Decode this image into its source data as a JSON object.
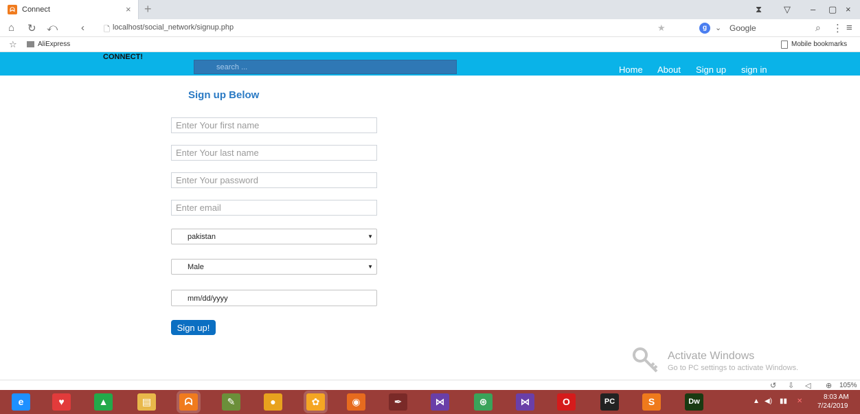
{
  "browser": {
    "tab_title": "Connect",
    "tab_favicon": "connect-icon",
    "tab_close": "×",
    "new_tab": "+",
    "url": "localhost/social_network/signup.php",
    "search_engine": "Google",
    "window_controls": [
      "⧗",
      "▽",
      "–",
      "▢",
      "×"
    ]
  },
  "bookmarks": {
    "items": [
      {
        "label": "AliExpress"
      }
    ],
    "mobile_label": "Mobile bookmarks"
  },
  "site": {
    "brand": "CONNECT!",
    "search_placeholder": "search ...",
    "nav": [
      "Home",
      "About",
      "Sign up",
      "sign in"
    ],
    "accent": "#0ab3e8"
  },
  "form": {
    "title": "Sign up Below",
    "first_name_placeholder": "Enter Your first name",
    "last_name_placeholder": "Enter Your last name",
    "password_placeholder": "Enter Your password",
    "email_placeholder": "Enter email",
    "country_value": "pakistan",
    "gender_value": "Male",
    "date_placeholder": "mm/dd/yyyy",
    "submit_label": "Sign up!"
  },
  "watermark": {
    "title": "Activate Windows",
    "subtitle": "Go to PC settings to activate Windows."
  },
  "statusbar": {
    "zoom": "105%"
  },
  "taskbar": {
    "apps": [
      {
        "name": "internet-explorer",
        "glyph": "e",
        "color": "#1e90ff"
      },
      {
        "name": "shield-app",
        "glyph": "♥",
        "color": "#e23b3b"
      },
      {
        "name": "google-drive",
        "glyph": "▲",
        "color": "#23a94a"
      },
      {
        "name": "file-explorer",
        "glyph": "▤",
        "color": "#e8b84a"
      },
      {
        "name": "xampp",
        "glyph": "ᗣ",
        "color": "#f07b1e"
      },
      {
        "name": "notepad",
        "glyph": "✎",
        "color": "#6b8f3a"
      },
      {
        "name": "chrome",
        "glyph": "●",
        "color": "#e8a21e"
      },
      {
        "name": "uc-browser",
        "glyph": "✿",
        "color": "#f5a623"
      },
      {
        "name": "firefox",
        "glyph": "◉",
        "color": "#e76b1e"
      },
      {
        "name": "pen-tool",
        "glyph": "✒",
        "color": "#7a2a28"
      },
      {
        "name": "visual-studio",
        "glyph": "⋈",
        "color": "#6a3fa8"
      },
      {
        "name": "android-studio",
        "glyph": "⊛",
        "color": "#3aa35a"
      },
      {
        "name": "visual-studio-2",
        "glyph": "⋈",
        "color": "#6a3fa8"
      },
      {
        "name": "opera",
        "glyph": "O",
        "color": "#d51b1b"
      },
      {
        "name": "pycharm",
        "glyph": "PC",
        "color": "#222"
      },
      {
        "name": "sublime-text",
        "glyph": "S",
        "color": "#ef7a1c"
      },
      {
        "name": "dreamweaver",
        "glyph": "Dw",
        "color": "#1a3a12"
      }
    ],
    "clock_time": "8:03 AM",
    "clock_date": "7/24/2019"
  }
}
